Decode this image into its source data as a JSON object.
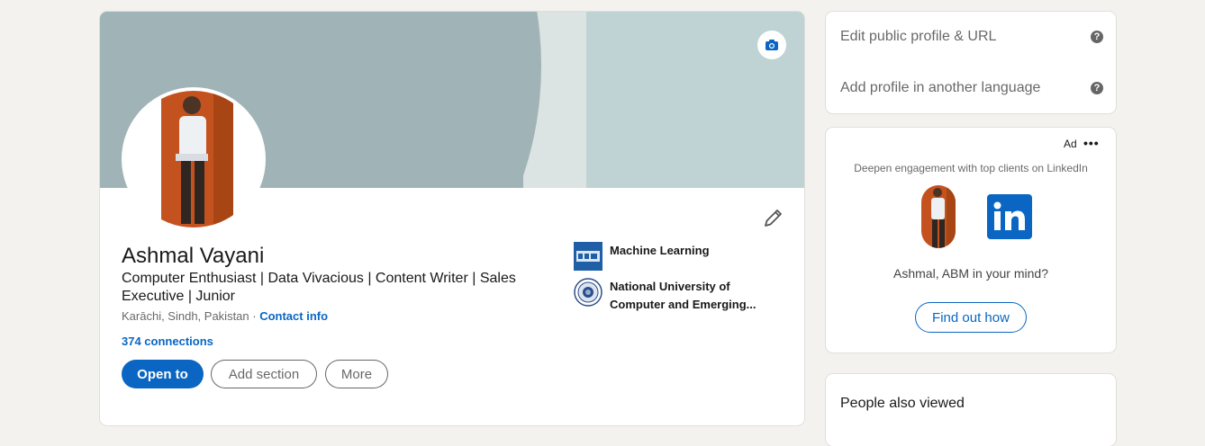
{
  "profile": {
    "name": "Ashmal Vayani",
    "headline": "Computer Enthusiast | Data Vivacious | Content Writer | Sales Executive | Junior",
    "location": "Karāchi, Sindh, Pakistan",
    "location_separator": " · ",
    "contact_info_label": "Contact info",
    "connections": "374 connections",
    "buttons": {
      "open_to": "Open to",
      "add_section": "Add section",
      "more": "More"
    },
    "experience": [
      {
        "label": "Machine Learning",
        "icon": "machine-learning-logo"
      },
      {
        "label": "National University of Computer and Emerging...",
        "icon": "university-seal-logo"
      }
    ]
  },
  "sidebar": {
    "settings": {
      "edit_public_profile": "Edit public profile & URL",
      "add_language": "Add profile in another language",
      "help_glyph": "?"
    },
    "ad": {
      "label": "Ad",
      "menu": "•••",
      "tagline": "Deepen engagement with top clients on LinkedIn",
      "logo_text": "in",
      "text": "Ashmal, ABM in your mind?",
      "button": "Find out how"
    },
    "people_also_viewed": "People also viewed"
  },
  "colors": {
    "brand_blue": "#0a66c2",
    "banner_main": "#a0b4b7",
    "banner_right": "#bfd3d4",
    "page_bg": "#f3f2ef"
  }
}
